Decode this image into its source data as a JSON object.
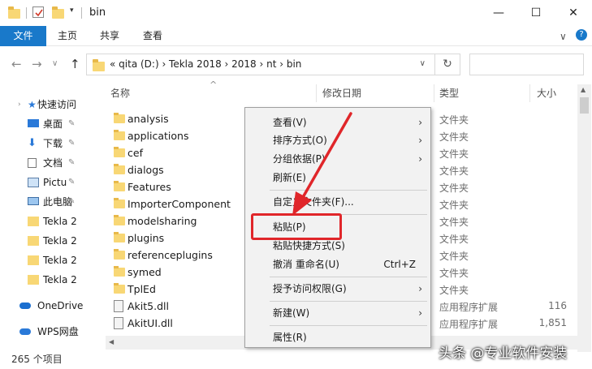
{
  "window": {
    "title": "bin",
    "minimize": "—",
    "maximize": "☐",
    "close": "✕"
  },
  "ribbon": {
    "tabs": [
      "文件",
      "主页",
      "共享",
      "查看"
    ],
    "collapse_icon": "∨",
    "help_icon": "?"
  },
  "address": {
    "path": "«  qita (D:)  ›  Tekla 2018  ›  2018  ›  nt  ›  bin",
    "dropdown": "∨",
    "refresh": "↻"
  },
  "nav": {
    "back": "←",
    "forward": "→",
    "recent": "∨",
    "up": "↑",
    "items": [
      {
        "label": "快速访问",
        "icon": "star-icon"
      },
      {
        "label": "桌面",
        "icon": "desktop-icon"
      },
      {
        "label": "下载",
        "icon": "download-icon"
      },
      {
        "label": "文档",
        "icon": "document-icon"
      },
      {
        "label": "Pictu",
        "icon": "pictures-icon"
      },
      {
        "label": "此电脑",
        "icon": "computer-icon"
      },
      {
        "label": "Tekla 2",
        "icon": "folder-icon"
      },
      {
        "label": "Tekla 2",
        "icon": "folder-icon"
      },
      {
        "label": "Tekla 2",
        "icon": "folder-icon"
      },
      {
        "label": "Tekla 2",
        "icon": "folder-icon"
      },
      {
        "label": "OneDrive",
        "icon": "onedrive-icon"
      },
      {
        "label": "WPS网盘",
        "icon": "wps-cloud-icon"
      }
    ]
  },
  "columns": {
    "name": "名称",
    "modified": "修改日期",
    "type": "类型",
    "size": "大小",
    "sort_indicator": "^"
  },
  "files": [
    {
      "name": "analysis",
      "kind": "folder",
      "type": "文件夹",
      "size": ""
    },
    {
      "name": "applications",
      "kind": "folder",
      "type": "文件夹",
      "size": ""
    },
    {
      "name": "cef",
      "kind": "folder",
      "type": "文件夹",
      "size": ""
    },
    {
      "name": "dialogs",
      "kind": "folder",
      "type": "文件夹",
      "size": ""
    },
    {
      "name": "Features",
      "kind": "folder",
      "type": "文件夹",
      "size": ""
    },
    {
      "name": "ImporterComponent",
      "kind": "folder",
      "type": "文件夹",
      "size": ""
    },
    {
      "name": "modelsharing",
      "kind": "folder",
      "type": "文件夹",
      "size": ""
    },
    {
      "name": "plugins",
      "kind": "folder",
      "type": "文件夹",
      "size": ""
    },
    {
      "name": "referenceplugins",
      "kind": "folder",
      "type": "文件夹",
      "size": ""
    },
    {
      "name": "symed",
      "kind": "folder",
      "type": "文件夹",
      "size": ""
    },
    {
      "name": "TplEd",
      "kind": "folder",
      "type": "文件夹",
      "size": ""
    },
    {
      "name": "Akit5.dll",
      "kind": "dll",
      "type": "应用程序扩展",
      "size": "116"
    },
    {
      "name": "AkitUI.dll",
      "kind": "dll",
      "type": "应用程序扩展",
      "size": "1,851"
    }
  ],
  "status": {
    "count": "265 个项目"
  },
  "context_menu": {
    "items": [
      {
        "label": "查看(V)",
        "shortcut": "",
        "submenu": true
      },
      {
        "label": "排序方式(O)",
        "shortcut": "",
        "submenu": true
      },
      {
        "label": "分组依据(P)",
        "shortcut": "",
        "submenu": true
      },
      {
        "label": "刷新(E)",
        "shortcut": "",
        "submenu": false
      },
      {
        "label": "自定义文件夹(F)...",
        "shortcut": "",
        "submenu": false
      },
      {
        "label": "粘贴(P)",
        "shortcut": "",
        "submenu": false
      },
      {
        "label": "粘贴快捷方式(S)",
        "shortcut": "",
        "submenu": false
      },
      {
        "label": "撤消 重命名(U)",
        "shortcut": "Ctrl+Z",
        "submenu": false
      },
      {
        "label": "授予访问权限(G)",
        "shortcut": "",
        "submenu": true
      },
      {
        "label": "新建(W)",
        "shortcut": "",
        "submenu": true
      },
      {
        "label": "属性(R)",
        "shortcut": "",
        "submenu": false
      }
    ],
    "submenu_arrow": "›"
  },
  "watermark": "头条 @专业软件安装",
  "colors": {
    "accent": "#1979ca",
    "highlight": "#e0262a",
    "folder": "#f8d775"
  }
}
